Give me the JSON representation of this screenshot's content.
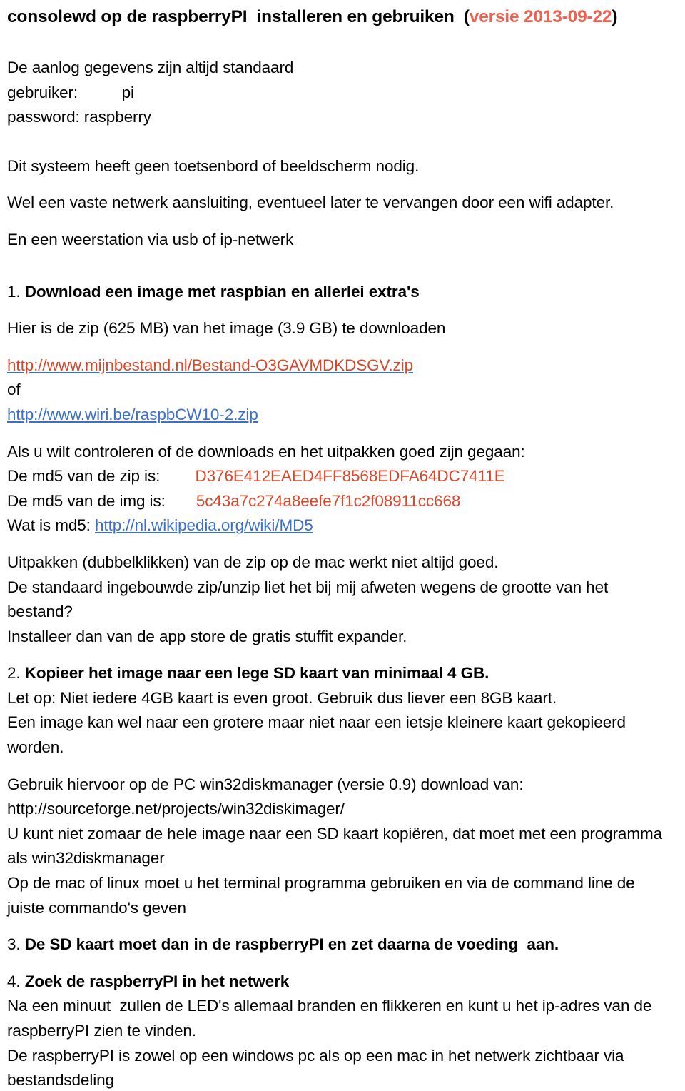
{
  "document": {
    "language": "nl",
    "colors": {
      "text": "#000000",
      "accent_red": "#ee6150",
      "hash_red": "#d9472a",
      "link_blue": "#3b6fcc",
      "background": "#ffffff"
    },
    "title": {
      "main": "consolewd op de raspberryPI  installeren en gebruiken  (",
      "version": "versie 2013-09-22",
      "close_paren": ")"
    },
    "intro": {
      "line1": "De aanlog gegevens zijn altijd standaard",
      "line2": "gebruiker:          pi",
      "line3": "password: raspberry",
      "line4": "Dit systeem heeft geen toetsenbord of beeldscherm nodig.",
      "line5": "Wel een vaste netwerk aansluiting, eventueel later te vervangen door een wifi adapter.",
      "line6": "En een weerstation via usb of ip-netwerk"
    },
    "section1": {
      "number": "1. ",
      "heading": "Download een image met raspbian en allerlei extra's",
      "line1": "Hier is de zip (625 MB) van het image (3.9 GB) te downloaden",
      "link1": "http://www.mijnbestand.nl/Bestand-O3GAVMDKDSGV.zip",
      "or": "of",
      "link2": "http://www.wiri.be/raspbCW10-2.zip",
      "check_intro": "Als u wilt controleren of de downloads en het uitpakken goed zijn gegaan:",
      "md5_zip_label": "De md5 van de zip is:        ",
      "md5_zip_value": "D376E412EAED4FF8568EDFA64DC7411E",
      "md5_img_label": "De md5 van de img is:       ",
      "md5_img_value": "5c43a7c274a8eefe7f1c2f08911cc668",
      "md5_what_label": "Wat is md5: ",
      "md5_what_link": "http://nl.wikipedia.org/wiki/MD5",
      "unzip1": "Uitpakken (dubbelklikken) van de zip op de mac werkt niet altijd goed.",
      "unzip2": "De standaard ingebouwde zip/unzip liet het bij mij afweten wegens de grootte van het bestand?",
      "unzip3": "Installeer dan van de app store de gratis stuffit expander."
    },
    "section2": {
      "number": "2. ",
      "heading": "Kopieer het image naar een lege SD kaart van minimaal 4 GB.",
      "line1": "Let op: Niet iedere 4GB kaart is even groot. Gebruik dus liever een 8GB kaart.",
      "line2": "Een image kan wel naar een grotere maar niet naar een ietsje kleinere kaart gekopieerd worden.",
      "line3": "Gebruik hiervoor op de PC win32diskmanager (versie 0.9) download van: http://sourceforge.net/projects/win32diskimager/",
      "line4": "U kunt niet zomaar de hele image naar een SD kaart kopiëren, dat moet met een programma als win32diskmanager",
      "line5": "Op de mac of linux moet u het terminal programma gebruiken en via de command line de juiste commando's geven"
    },
    "section3": {
      "number": "3. ",
      "heading": "De SD kaart moet dan in de raspberryPI en zet daarna de voeding  aan."
    },
    "section4": {
      "number": "4. ",
      "heading": "Zoek de raspberryPI in het netwerk",
      "line1": "Na een minuut  zullen de LED's allemaal branden en flikkeren en kunt u het ip-adres van de raspberryPI zien te vinden.",
      "line2": "De raspberryPI is zowel op een windows pc als op een mac in het netwerk zichtbaar via bestandsdeling"
    }
  }
}
